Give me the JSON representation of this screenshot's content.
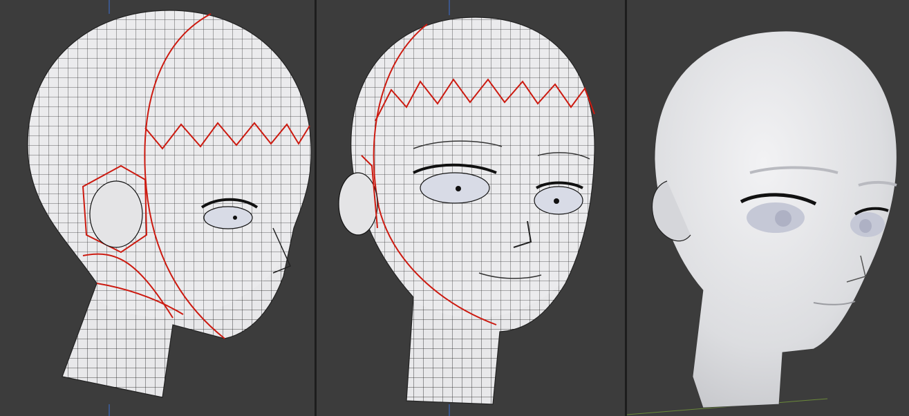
{
  "viewports": [
    {
      "shading": "wireframe",
      "view": "three-quarter"
    },
    {
      "shading": "wireframe",
      "view": "front-three-quarter"
    },
    {
      "shading": "solid",
      "view": "three-quarter"
    }
  ],
  "colors": {
    "viewport_bg": "#3c3c3c",
    "divider": "#1d1d1d",
    "mesh": "#e6e6e8",
    "wire": "#111111",
    "seam": "#cc1a10",
    "y_axis": "#3d6fd6",
    "x_axis": "#6b8a3a"
  }
}
